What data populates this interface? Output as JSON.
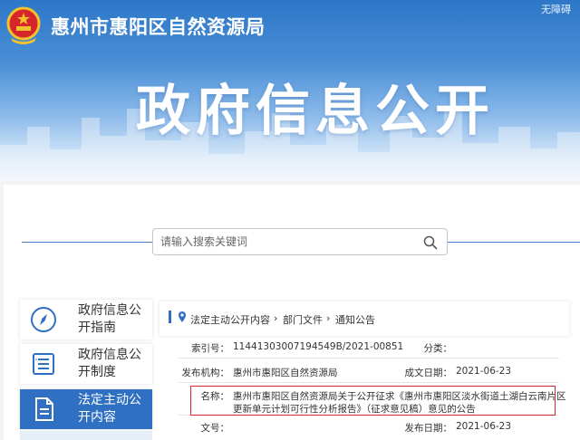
{
  "header": {
    "site_title": "惠州市惠阳区自然资源局",
    "hero_title": "政府信息公开",
    "accessibility_link": "无障碍"
  },
  "search": {
    "placeholder": "请输入搜索关键词"
  },
  "sidebar": {
    "items": [
      {
        "label": "政府信息公开指南",
        "icon": "compass-icon",
        "active": false
      },
      {
        "label": "政府信息公开制度",
        "icon": "document-list-icon",
        "active": false
      },
      {
        "label": "法定主动公开内容",
        "icon": "file-icon",
        "active": true
      }
    ]
  },
  "breadcrumb": {
    "items": [
      "法定主动公开内容",
      "部门文件",
      "通知公告"
    ],
    "separator": "›"
  },
  "info": {
    "index_label": "索引号：",
    "index_value": "11441303007194549B/2021-00851",
    "category_label": "分类：",
    "category_value": "",
    "publisher_label": "发布机构：",
    "publisher_value": "惠州市惠阳区自然资源局",
    "created_label": "成文日期：",
    "created_value": "2021-06-23",
    "name_label": "名称：",
    "name_value_line1": "惠州市惠阳区自然资源局关于公开征求《惠州市惠阳区淡水街道土湖白云南片区",
    "name_value_line2": "更新单元计划可行性分析报告》（征求意见稿）意见的公告",
    "docno_label": "文号：",
    "docno_value": "",
    "published_label": "发布日期：",
    "published_value": "2021-06-23"
  },
  "colors": {
    "brand_blue": "#2f70c3",
    "highlight_red": "#d9262a"
  }
}
